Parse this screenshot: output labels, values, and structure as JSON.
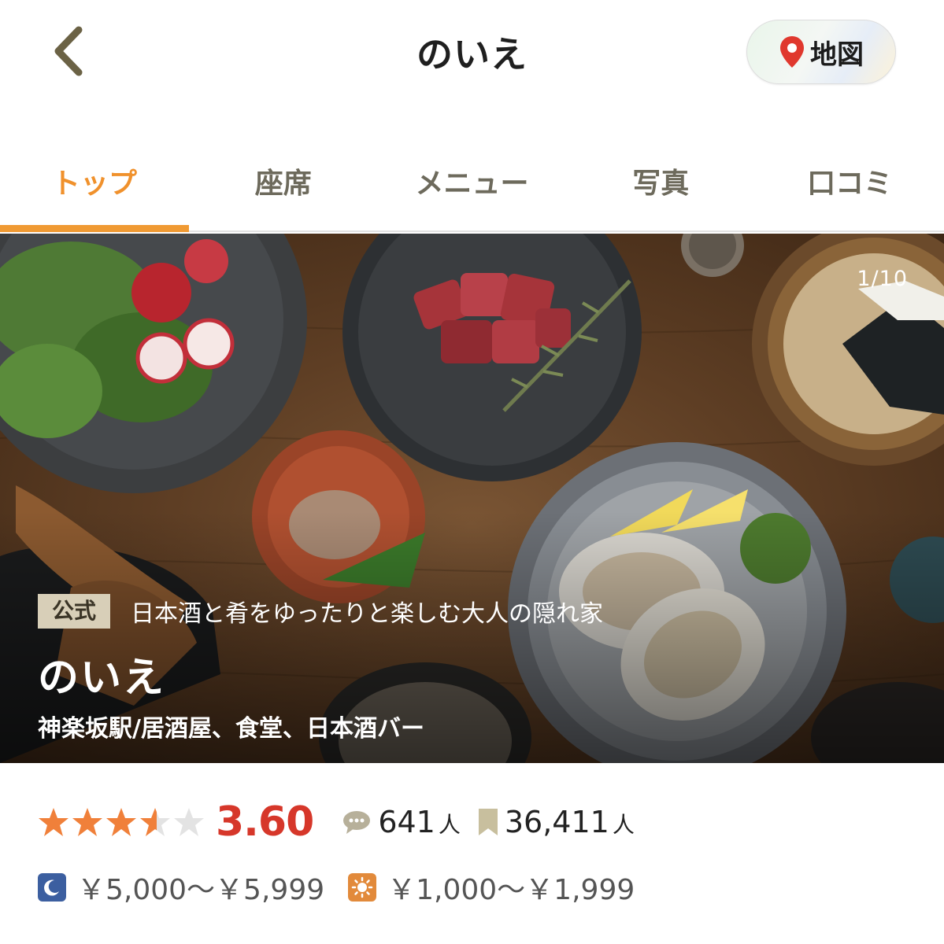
{
  "header": {
    "title": "のいえ",
    "back_icon": "chevron-left-icon",
    "map_label": "地図",
    "map_icon": "map-pin-icon"
  },
  "tabs": [
    {
      "label": "トップ",
      "active": true
    },
    {
      "label": "座席",
      "active": false
    },
    {
      "label": "メニュー",
      "active": false
    },
    {
      "label": "写真",
      "active": false
    },
    {
      "label": "口コミ",
      "active": false
    }
  ],
  "hero": {
    "photo_counter": "1/10",
    "official_badge": "公式",
    "tagline": "日本酒と肴をゆったりと楽しむ大人の隠れ家",
    "name": "のいえ",
    "meta": "神楽坂駅/居酒屋、食堂、日本酒バー"
  },
  "rating": {
    "stars_value": 3.6,
    "stars_max": 5,
    "score": "3.60",
    "reviews_count": "641",
    "reviews_unit": "人",
    "reviews_icon": "comment-bubble-icon",
    "saves_count": "36,411",
    "saves_unit": "人",
    "saves_icon": "bookmark-icon"
  },
  "prices": {
    "dinner_icon": "moon-icon",
    "dinner": "￥5,000～￥5,999",
    "lunch_icon": "sun-icon",
    "lunch": "￥1,000～￥1,999"
  },
  "colors": {
    "accent": "#f0912c",
    "score": "#d6372a",
    "star": "#f0803a",
    "star_empty": "#e3e3e3",
    "dinner_icon_bg": "#3c5fa0",
    "lunch_icon_bg": "#e28a3b"
  }
}
